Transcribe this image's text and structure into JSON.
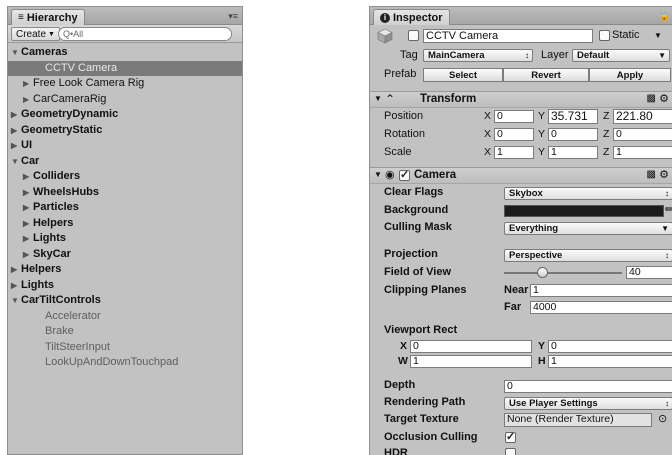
{
  "hierarchy": {
    "tab_label": "Hierarchy",
    "create_label": "Create",
    "search_placeholder": "Q•All",
    "items": [
      {
        "label": "Cameras",
        "depth": 0,
        "arrow": "down",
        "bold": true
      },
      {
        "label": "CCTV Camera",
        "depth": 2,
        "arrow": "none",
        "selected": true
      },
      {
        "label": "Free Look Camera Rig",
        "depth": 1,
        "arrow": "right"
      },
      {
        "label": "CarCameraRig",
        "depth": 1,
        "arrow": "right"
      },
      {
        "label": "GeometryDynamic",
        "depth": 0,
        "arrow": "right",
        "bold": true
      },
      {
        "label": "GeometryStatic",
        "depth": 0,
        "arrow": "right",
        "bold": true
      },
      {
        "label": "UI",
        "depth": 0,
        "arrow": "right",
        "bold": true
      },
      {
        "label": "Car",
        "depth": 0,
        "arrow": "down",
        "bold": true
      },
      {
        "label": "Colliders",
        "depth": 1,
        "arrow": "right",
        "bold": true
      },
      {
        "label": "WheelsHubs",
        "depth": 1,
        "arrow": "right",
        "bold": true
      },
      {
        "label": "Particles",
        "depth": 1,
        "arrow": "right",
        "bold": true
      },
      {
        "label": "Helpers",
        "depth": 1,
        "arrow": "right",
        "bold": true
      },
      {
        "label": "Lights",
        "depth": 1,
        "arrow": "right",
        "bold": true
      },
      {
        "label": "SkyCar",
        "depth": 1,
        "arrow": "right",
        "bold": true
      },
      {
        "label": "Helpers",
        "depth": 0,
        "arrow": "right",
        "bold": true
      },
      {
        "label": "Lights",
        "depth": 0,
        "arrow": "right",
        "bold": true
      },
      {
        "label": "CarTiltControls",
        "depth": 0,
        "arrow": "down",
        "bold": true
      },
      {
        "label": "Accelerator",
        "depth": 2,
        "arrow": "none",
        "dim": true
      },
      {
        "label": "Brake",
        "depth": 2,
        "arrow": "none",
        "dim": true
      },
      {
        "label": "TiltSteerInput",
        "depth": 2,
        "arrow": "none",
        "dim": true
      },
      {
        "label": "LookUpAndDownTouchpad",
        "depth": 2,
        "arrow": "none",
        "dim": true
      }
    ]
  },
  "inspector": {
    "tab_label": "Inspector",
    "object_name": "CCTV Camera",
    "static_label": "Static",
    "tag_label": "Tag",
    "tag_value": "MainCamera",
    "layer_label": "Layer",
    "layer_value": "Default",
    "prefab_label": "Prefab",
    "prefab_select": "Select",
    "prefab_revert": "Revert",
    "prefab_apply": "Apply",
    "transform": {
      "title": "Transform",
      "position_label": "Position",
      "rotation_label": "Rotation",
      "scale_label": "Scale",
      "position": {
        "x": "0",
        "y": "35.731",
        "z": "221.80"
      },
      "rotation": {
        "x": "0",
        "y": "0",
        "z": "0"
      },
      "scale": {
        "x": "1",
        "y": "1",
        "z": "1"
      }
    },
    "camera": {
      "title": "Camera",
      "clear_flags_label": "Clear Flags",
      "clear_flags_value": "Skybox",
      "background_label": "Background",
      "background_color": "#1c1c1c",
      "culling_mask_label": "Culling Mask",
      "culling_mask_value": "Everything",
      "projection_label": "Projection",
      "projection_value": "Perspective",
      "fov_label": "Field of View",
      "fov_value": "40",
      "clipping_label": "Clipping Planes",
      "near_label": "Near",
      "near_value": "1",
      "far_label": "Far",
      "far_value": "4000",
      "viewport_label": "Viewport Rect",
      "viewport": {
        "x": "0",
        "y": "0",
        "w": "1",
        "h": "1"
      },
      "depth_label": "Depth",
      "depth_value": "0",
      "rendering_path_label": "Rendering Path",
      "rendering_path_value": "Use Player Settings",
      "target_texture_label": "Target Texture",
      "target_texture_value": "None (Render Texture)",
      "occlusion_label": "Occlusion Culling",
      "hdr_label": "HDR"
    },
    "axis_x": "X",
    "axis_y": "Y",
    "axis_z": "Z",
    "axis_w": "W",
    "axis_h": "H"
  }
}
